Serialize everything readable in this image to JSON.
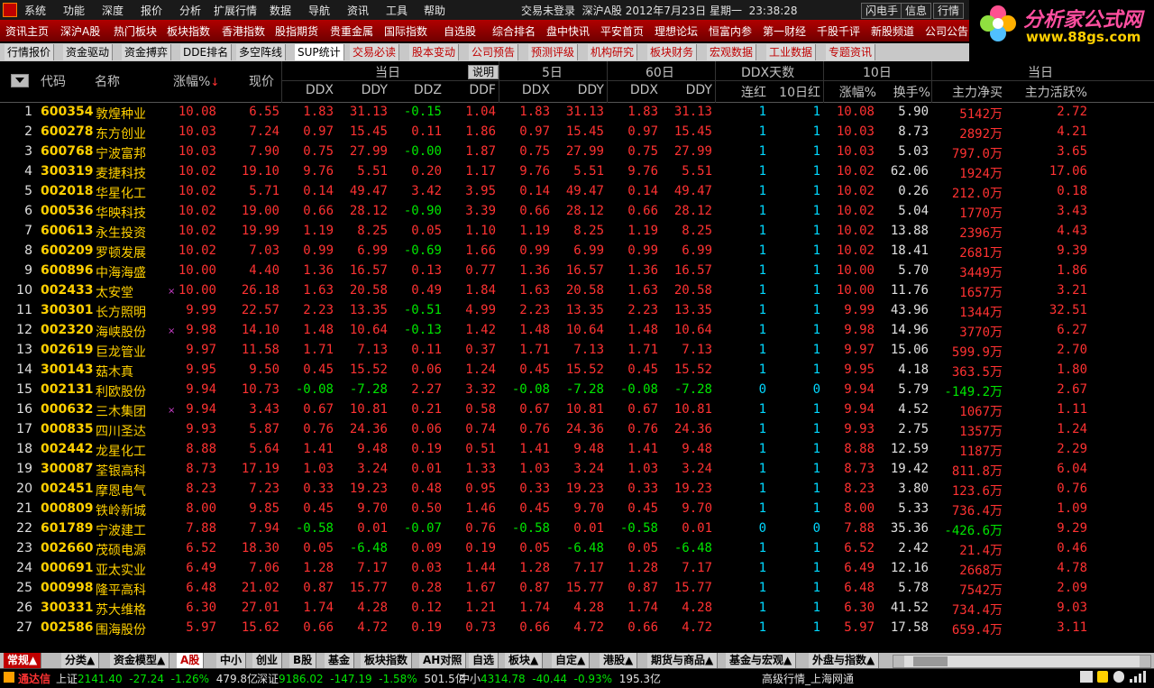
{
  "menu": [
    "系统",
    "功能",
    "深度",
    "报价",
    "分析",
    "扩展行情",
    "数据",
    "导航",
    "资讯",
    "工具",
    "帮助"
  ],
  "status": {
    "login": "交易未登录",
    "market": "深沪A股",
    "date": "2012年7月23日",
    "weekday": "星期一",
    "time": "23:38:28"
  },
  "top_buttons": [
    "闪电手",
    "信息",
    "行情"
  ],
  "logo": {
    "title": "分析家公式网",
    "url": "www.88gs.com"
  },
  "nav": [
    "资讯主页",
    "深沪A股",
    "热门板块",
    "板块指数",
    "香港指数",
    "股指期货",
    "贵重金属",
    "国际指数",
    "自选股",
    "综合排名",
    "盘中快讯",
    "平安首页",
    "理想论坛",
    "恒富内参",
    "第一财经",
    "千股千评",
    "新股频道",
    "公司公告"
  ],
  "tabs": [
    {
      "label": "行情报价",
      "style": "normal"
    },
    {
      "label": "资金驱动",
      "style": "normal"
    },
    {
      "label": "资金搏弈",
      "style": "normal"
    },
    {
      "label": "DDE排名",
      "style": "normal"
    },
    {
      "label": "多空阵线",
      "style": "normal"
    },
    {
      "label": "SUP统计",
      "style": "sel"
    },
    {
      "label": "交易必读",
      "style": "red"
    },
    {
      "label": "股本变动",
      "style": "red"
    },
    {
      "label": "公司预告",
      "style": "red"
    },
    {
      "label": "预测评级",
      "style": "red"
    },
    {
      "label": "机构研究",
      "style": "red"
    },
    {
      "label": "板块财务",
      "style": "red"
    },
    {
      "label": "宏观数据",
      "style": "red"
    },
    {
      "label": "工业数据",
      "style": "red"
    },
    {
      "label": "专题资讯",
      "style": "red"
    }
  ],
  "header": {
    "groups": {
      "today": "当日",
      "explain": "说明",
      "d5": "5日",
      "d60": "60日",
      "ddx_days": "DDX天数",
      "d10": "10日",
      "today2": "当日"
    },
    "cols": {
      "code": "代码",
      "name": "名称",
      "chg": "涨幅%",
      "price": "现价",
      "ddx": "DDX",
      "ddy": "DDY",
      "ddz": "DDZ",
      "ddf": "DDF",
      "ddx5": "DDX",
      "ddy5": "DDY",
      "ddx60": "DDX",
      "ddy60": "DDY",
      "lianhong": "连红",
      "hong10": "10日红",
      "chg10": "涨幅%",
      "turnover": "换手%",
      "net": "主力净买",
      "active": "主力活跃%"
    },
    "sort_arrow": "↓"
  },
  "rows": [
    [
      "1",
      "600354",
      "敦煌种业",
      "",
      "10.08",
      "6.55",
      "1.83",
      "31.13",
      "-0.15",
      "1.04",
      "1.83",
      "31.13",
      "1.83",
      "31.13",
      "1",
      "1",
      "10.08",
      "5.90",
      "5142万",
      "2.72"
    ],
    [
      "2",
      "600278",
      "东方创业",
      "",
      "10.03",
      "7.24",
      "0.97",
      "15.45",
      "0.11",
      "1.86",
      "0.97",
      "15.45",
      "0.97",
      "15.45",
      "1",
      "1",
      "10.03",
      "8.73",
      "2892万",
      "4.21"
    ],
    [
      "3",
      "600768",
      "宁波富邦",
      "",
      "10.03",
      "7.90",
      "0.75",
      "27.99",
      "-0.00",
      "1.87",
      "0.75",
      "27.99",
      "0.75",
      "27.99",
      "1",
      "1",
      "10.03",
      "5.03",
      "797.0万",
      "3.65"
    ],
    [
      "4",
      "300319",
      "麦捷科技",
      "",
      "10.02",
      "19.10",
      "9.76",
      "5.51",
      "0.20",
      "1.17",
      "9.76",
      "5.51",
      "9.76",
      "5.51",
      "1",
      "1",
      "10.02",
      "62.06",
      "1924万",
      "17.06"
    ],
    [
      "5",
      "002018",
      "华星化工",
      "",
      "10.02",
      "5.71",
      "0.14",
      "49.47",
      "3.42",
      "3.95",
      "0.14",
      "49.47",
      "0.14",
      "49.47",
      "1",
      "1",
      "10.02",
      "0.26",
      "212.0万",
      "0.18"
    ],
    [
      "6",
      "000536",
      "华映科技",
      "",
      "10.02",
      "19.00",
      "0.66",
      "28.12",
      "-0.90",
      "3.39",
      "0.66",
      "28.12",
      "0.66",
      "28.12",
      "1",
      "1",
      "10.02",
      "5.04",
      "1770万",
      "3.43"
    ],
    [
      "7",
      "600613",
      "永生投资",
      "",
      "10.02",
      "19.99",
      "1.19",
      "8.25",
      "0.05",
      "1.10",
      "1.19",
      "8.25",
      "1.19",
      "8.25",
      "1",
      "1",
      "10.02",
      "13.88",
      "2396万",
      "4.43"
    ],
    [
      "8",
      "600209",
      "罗顿发展",
      "",
      "10.02",
      "7.03",
      "0.99",
      "6.99",
      "-0.69",
      "1.66",
      "0.99",
      "6.99",
      "0.99",
      "6.99",
      "1",
      "1",
      "10.02",
      "18.41",
      "2681万",
      "9.39"
    ],
    [
      "9",
      "600896",
      "中海海盛",
      "",
      "10.00",
      "4.40",
      "1.36",
      "16.57",
      "0.13",
      "0.77",
      "1.36",
      "16.57",
      "1.36",
      "16.57",
      "1",
      "1",
      "10.00",
      "5.70",
      "3449万",
      "1.86"
    ],
    [
      "10",
      "002433",
      "太安堂",
      "×",
      "10.00",
      "26.18",
      "1.63",
      "20.58",
      "0.49",
      "1.84",
      "1.63",
      "20.58",
      "1.63",
      "20.58",
      "1",
      "1",
      "10.00",
      "11.76",
      "1657万",
      "3.21"
    ],
    [
      "11",
      "300301",
      "长方照明",
      "",
      "9.99",
      "22.57",
      "2.23",
      "13.35",
      "-0.51",
      "4.99",
      "2.23",
      "13.35",
      "2.23",
      "13.35",
      "1",
      "1",
      "9.99",
      "43.96",
      "1344万",
      "32.51"
    ],
    [
      "12",
      "002320",
      "海峡股份",
      "×",
      "9.98",
      "14.10",
      "1.48",
      "10.64",
      "-0.13",
      "1.42",
      "1.48",
      "10.64",
      "1.48",
      "10.64",
      "1",
      "1",
      "9.98",
      "14.96",
      "3770万",
      "6.27"
    ],
    [
      "13",
      "002619",
      "巨龙管业",
      "",
      "9.97",
      "11.58",
      "1.71",
      "7.13",
      "0.11",
      "0.37",
      "1.71",
      "7.13",
      "1.71",
      "7.13",
      "1",
      "1",
      "9.97",
      "15.06",
      "599.9万",
      "2.70"
    ],
    [
      "14",
      "300143",
      "菇木真",
      "",
      "9.95",
      "9.50",
      "0.45",
      "15.52",
      "0.06",
      "1.24",
      "0.45",
      "15.52",
      "0.45",
      "15.52",
      "1",
      "1",
      "9.95",
      "4.18",
      "363.5万",
      "1.80"
    ],
    [
      "15",
      "002131",
      "利欧股份",
      "",
      "9.94",
      "10.73",
      "-0.08",
      "-7.28",
      "2.27",
      "3.32",
      "-0.08",
      "-7.28",
      "-0.08",
      "-7.28",
      "0",
      "0",
      "9.94",
      "5.79",
      "-149.2万",
      "2.67"
    ],
    [
      "16",
      "000632",
      "三木集团",
      "×",
      "9.94",
      "3.43",
      "0.67",
      "10.81",
      "0.21",
      "0.58",
      "0.67",
      "10.81",
      "0.67",
      "10.81",
      "1",
      "1",
      "9.94",
      "4.52",
      "1067万",
      "1.11"
    ],
    [
      "17",
      "000835",
      "四川圣达",
      "",
      "9.93",
      "5.87",
      "0.76",
      "24.36",
      "0.06",
      "0.74",
      "0.76",
      "24.36",
      "0.76",
      "24.36",
      "1",
      "1",
      "9.93",
      "2.75",
      "1357万",
      "1.24"
    ],
    [
      "18",
      "002442",
      "龙星化工",
      "",
      "8.88",
      "5.64",
      "1.41",
      "9.48",
      "0.19",
      "0.51",
      "1.41",
      "9.48",
      "1.41",
      "9.48",
      "1",
      "1",
      "8.88",
      "12.59",
      "1187万",
      "2.29"
    ],
    [
      "19",
      "300087",
      "荃银高科",
      "",
      "8.73",
      "17.19",
      "1.03",
      "3.24",
      "0.01",
      "1.33",
      "1.03",
      "3.24",
      "1.03",
      "3.24",
      "1",
      "1",
      "8.73",
      "19.42",
      "811.8万",
      "6.04"
    ],
    [
      "20",
      "002451",
      "摩恩电气",
      "",
      "8.23",
      "7.23",
      "0.33",
      "19.23",
      "0.48",
      "0.95",
      "0.33",
      "19.23",
      "0.33",
      "19.23",
      "1",
      "1",
      "8.23",
      "3.80",
      "123.6万",
      "0.76"
    ],
    [
      "21",
      "000809",
      "铁岭新城",
      "",
      "8.00",
      "9.85",
      "0.45",
      "9.70",
      "0.50",
      "1.46",
      "0.45",
      "9.70",
      "0.45",
      "9.70",
      "1",
      "1",
      "8.00",
      "5.33",
      "736.4万",
      "1.09"
    ],
    [
      "22",
      "601789",
      "宁波建工",
      "",
      "7.88",
      "7.94",
      "-0.58",
      "0.01",
      "-0.07",
      "0.76",
      "-0.58",
      "0.01",
      "-0.58",
      "0.01",
      "0",
      "0",
      "7.88",
      "35.36",
      "-426.6万",
      "9.29"
    ],
    [
      "23",
      "002660",
      "茂硕电源",
      "",
      "6.52",
      "18.30",
      "0.05",
      "-6.48",
      "0.09",
      "0.19",
      "0.05",
      "-6.48",
      "0.05",
      "-6.48",
      "1",
      "1",
      "6.52",
      "2.42",
      "21.4万",
      "0.46"
    ],
    [
      "24",
      "000691",
      "亚太实业",
      "",
      "6.49",
      "7.06",
      "1.28",
      "7.17",
      "0.03",
      "1.44",
      "1.28",
      "7.17",
      "1.28",
      "7.17",
      "1",
      "1",
      "6.49",
      "12.16",
      "2668万",
      "4.78"
    ],
    [
      "25",
      "000998",
      "隆平高科",
      "",
      "6.48",
      "21.02",
      "0.87",
      "15.77",
      "0.28",
      "1.67",
      "0.87",
      "15.77",
      "0.87",
      "15.77",
      "1",
      "1",
      "6.48",
      "5.78",
      "7542万",
      "2.09"
    ],
    [
      "26",
      "300331",
      "苏大维格",
      "",
      "6.30",
      "27.01",
      "1.74",
      "4.28",
      "0.12",
      "1.21",
      "1.74",
      "4.28",
      "1.74",
      "4.28",
      "1",
      "1",
      "6.30",
      "41.52",
      "734.4万",
      "9.03"
    ],
    [
      "27",
      "002586",
      "围海股份",
      "",
      "5.97",
      "15.62",
      "0.66",
      "4.72",
      "0.19",
      "0.73",
      "0.66",
      "4.72",
      "0.66",
      "4.72",
      "1",
      "1",
      "5.97",
      "17.58",
      "659.4万",
      "3.11"
    ]
  ],
  "bottom_tabs": [
    {
      "label": "常规▲",
      "style": "sel"
    },
    {
      "label": "分类▲",
      "style": "normal"
    },
    {
      "label": "资金模型▲",
      "style": "normal"
    },
    {
      "label": "A股",
      "style": "hl"
    },
    {
      "label": "中小",
      "style": "normal"
    },
    {
      "label": "创业",
      "style": "normal"
    },
    {
      "label": "B股",
      "style": "normal"
    },
    {
      "label": "基金",
      "style": "normal"
    },
    {
      "label": "板块指数",
      "style": "normal"
    },
    {
      "label": "AH对照",
      "style": "normal"
    },
    {
      "label": "自选",
      "style": "normal"
    },
    {
      "label": "板块▲",
      "style": "normal"
    },
    {
      "label": "自定▲",
      "style": "normal"
    },
    {
      "label": "港股▲",
      "style": "normal"
    },
    {
      "label": "期货与商品▲",
      "style": "normal"
    },
    {
      "label": "基金与宏观▲",
      "style": "normal"
    },
    {
      "label": "外盘与指数▲",
      "style": "normal"
    }
  ],
  "statusbar": {
    "brand": "通达信",
    "sh_label": "上证",
    "sh_val": "2141.40",
    "sh_chg": "-27.24",
    "sh_pct": "-1.26%",
    "sh_amt": "479.8亿",
    "sz_label": "深证",
    "sz_val": "9186.02",
    "sz_chg": "-147.19",
    "sz_pct": "-1.58%",
    "sz_amt": "501.5亿",
    "zx_label": "中小",
    "zx_val": "4314.78",
    "zx_chg": "-40.44",
    "zx_pct": "-0.93%",
    "zx_amt": "195.3亿",
    "server": "高级行情_上海网通"
  }
}
